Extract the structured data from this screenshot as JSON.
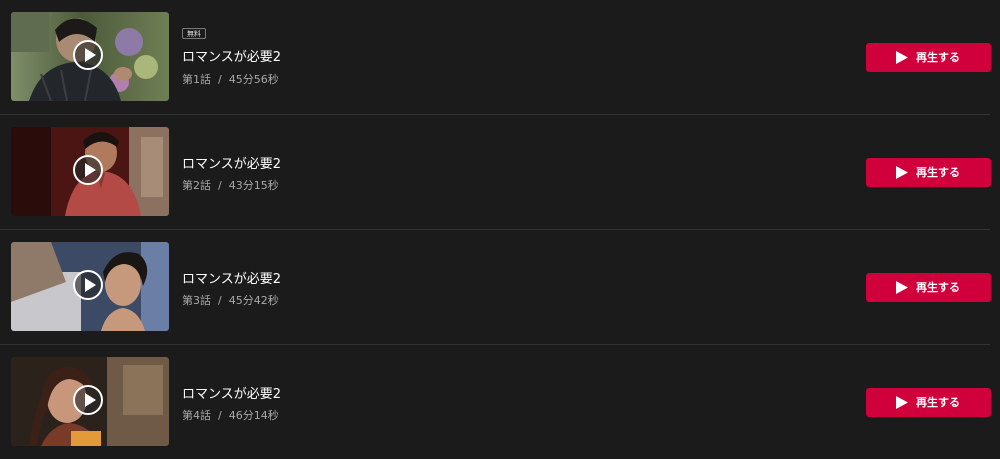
{
  "episodes": [
    {
      "badge": "無料",
      "title": "ロマンスが必要2",
      "episode_label": "第1話",
      "separator": "/",
      "duration": "45分56秒",
      "play_label": "再生する"
    },
    {
      "badge": "",
      "title": "ロマンスが必要2",
      "episode_label": "第2話",
      "separator": "/",
      "duration": "43分15秒",
      "play_label": "再生する"
    },
    {
      "badge": "",
      "title": "ロマンスが必要2",
      "episode_label": "第3話",
      "separator": "/",
      "duration": "45分42秒",
      "play_label": "再生する"
    },
    {
      "badge": "",
      "title": "ロマンスが必要2",
      "episode_label": "第4話",
      "separator": "/",
      "duration": "46分14秒",
      "play_label": "再生する"
    }
  ],
  "colors": {
    "background": "#1b1b1b",
    "divider": "#333333",
    "play_button": "#d0003c",
    "title_text": "#ffffff",
    "meta_text": "#a9a9a9"
  },
  "icons": {
    "thumbnail_overlay": "play-circle-icon",
    "button_icon": "play-triangle-icon"
  }
}
